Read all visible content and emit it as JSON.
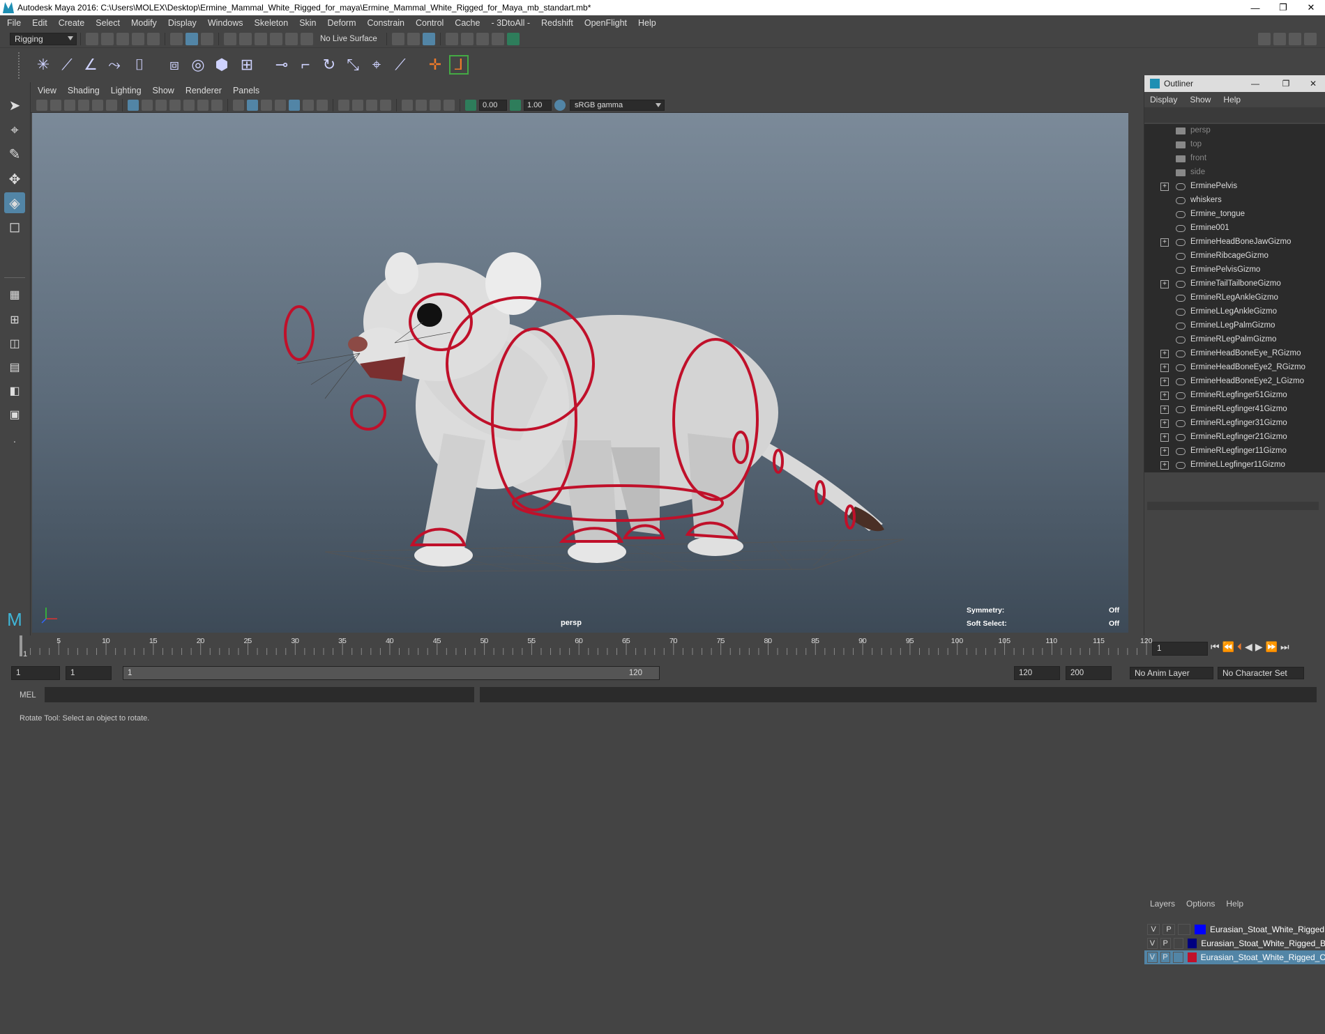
{
  "window": {
    "title": "Autodesk Maya 2016: C:\\Users\\MOLEX\\Desktop\\Ermine_Mammal_White_Rigged_for_maya\\Ermine_Mammal_White_Rigged_for_Maya_mb_standart.mb*",
    "minimize": "—",
    "restore": "❐",
    "close": "✕"
  },
  "menubar": [
    "File",
    "Edit",
    "Create",
    "Select",
    "Modify",
    "Display",
    "Windows",
    "Skeleton",
    "Skin",
    "Deform",
    "Constrain",
    "Control",
    "Cache",
    "- 3DtoAll -",
    "Redshift",
    "OpenFlight",
    "Help"
  ],
  "status": {
    "menuset": "Rigging",
    "live_surface": "No Live Surface"
  },
  "viewport": {
    "menus": [
      "View",
      "Shading",
      "Lighting",
      "Show",
      "Renderer",
      "Panels"
    ],
    "exposure": "0.00",
    "gamma": "1.00",
    "colorspace": "sRGB gamma",
    "camera_label": "persp",
    "symmetry_label": "Symmetry:",
    "symmetry_value": "Off",
    "softselect_label": "Soft Select:",
    "softselect_value": "Off"
  },
  "outliner": {
    "title": "Outliner",
    "menus": [
      "Display",
      "Show",
      "Help"
    ],
    "items": [
      {
        "label": "persp",
        "type": "camera",
        "expand": false
      },
      {
        "label": "top",
        "type": "camera",
        "expand": false
      },
      {
        "label": "front",
        "type": "camera",
        "expand": false
      },
      {
        "label": "side",
        "type": "camera",
        "expand": false
      },
      {
        "label": "ErminePelvis",
        "type": "joint",
        "expand": true
      },
      {
        "label": "whiskers",
        "type": "mesh",
        "expand": false
      },
      {
        "label": "Ermine_tongue",
        "type": "mesh",
        "expand": false
      },
      {
        "label": "Ermine001",
        "type": "mesh",
        "expand": false
      },
      {
        "label": "ErmineHeadBoneJawGizmo",
        "type": "mesh",
        "expand": true
      },
      {
        "label": "ErmineRibcageGizmo",
        "type": "mesh",
        "expand": false
      },
      {
        "label": "ErminePelvisGizmo",
        "type": "mesh",
        "expand": false
      },
      {
        "label": "ErmineTailTailboneGizmo",
        "type": "mesh",
        "expand": true
      },
      {
        "label": "ErmineRLegAnkleGizmo",
        "type": "mesh",
        "expand": false
      },
      {
        "label": "ErmineLLegAnkleGizmo",
        "type": "mesh",
        "expand": false
      },
      {
        "label": "ErmineLLegPalmGizmo",
        "type": "mesh",
        "expand": false
      },
      {
        "label": "ErmineRLegPalmGizmo",
        "type": "mesh",
        "expand": false
      },
      {
        "label": "ErmineHeadBoneEye_RGizmo",
        "type": "mesh",
        "expand": true
      },
      {
        "label": "ErmineHeadBoneEye2_RGizmo",
        "type": "mesh",
        "expand": true
      },
      {
        "label": "ErmineHeadBoneEye2_LGizmo",
        "type": "mesh",
        "expand": true
      },
      {
        "label": "ErmineRLegfinger51Gizmo",
        "type": "mesh",
        "expand": true
      },
      {
        "label": "ErmineRLegfinger41Gizmo",
        "type": "mesh",
        "expand": true
      },
      {
        "label": "ErmineRLegfinger31Gizmo",
        "type": "mesh",
        "expand": true
      },
      {
        "label": "ErmineRLegfinger21Gizmo",
        "type": "mesh",
        "expand": true
      },
      {
        "label": "ErmineRLegfinger11Gizmo",
        "type": "mesh",
        "expand": true
      },
      {
        "label": "ErmineLLegfinger11Gizmo",
        "type": "mesh",
        "expand": true
      }
    ],
    "expand_symbol": "+"
  },
  "layers": {
    "menus": [
      "Layers",
      "Options",
      "Help"
    ],
    "rows": [
      {
        "v": "V",
        "p": "P",
        "color": "#0000ff",
        "name": "Eurasian_Stoat_White_Rigged",
        "selected": false
      },
      {
        "v": "V",
        "p": "P",
        "color": "#000080",
        "name": "Eurasian_Stoat_White_Rigged_B",
        "selected": false
      },
      {
        "v": "V",
        "p": "P",
        "color": "#c0102a",
        "name": "Eurasian_Stoat_White_Rigged_C",
        "selected": true
      }
    ]
  },
  "timeline": {
    "ticks": [
      "5",
      "10",
      "15",
      "20",
      "25",
      "30",
      "35",
      "40",
      "45",
      "50",
      "55",
      "60",
      "65",
      "70",
      "75",
      "80",
      "85",
      "90",
      "95",
      "100",
      "105",
      "110",
      "115",
      "120"
    ],
    "start_tick": "1",
    "current_frame": "1"
  },
  "range": {
    "start": "1",
    "playback_start": "1",
    "slider_start": "1",
    "slider_end": "120",
    "playback_end": "120",
    "end": "200",
    "anim_layer": "No Anim Layer",
    "char_set": "No Character Set"
  },
  "cmdline": {
    "label": "MEL"
  },
  "helpline": {
    "text": "Rotate Tool: Select an object to rotate."
  },
  "accent": "#5285a6",
  "rig_color": "#c0102a"
}
